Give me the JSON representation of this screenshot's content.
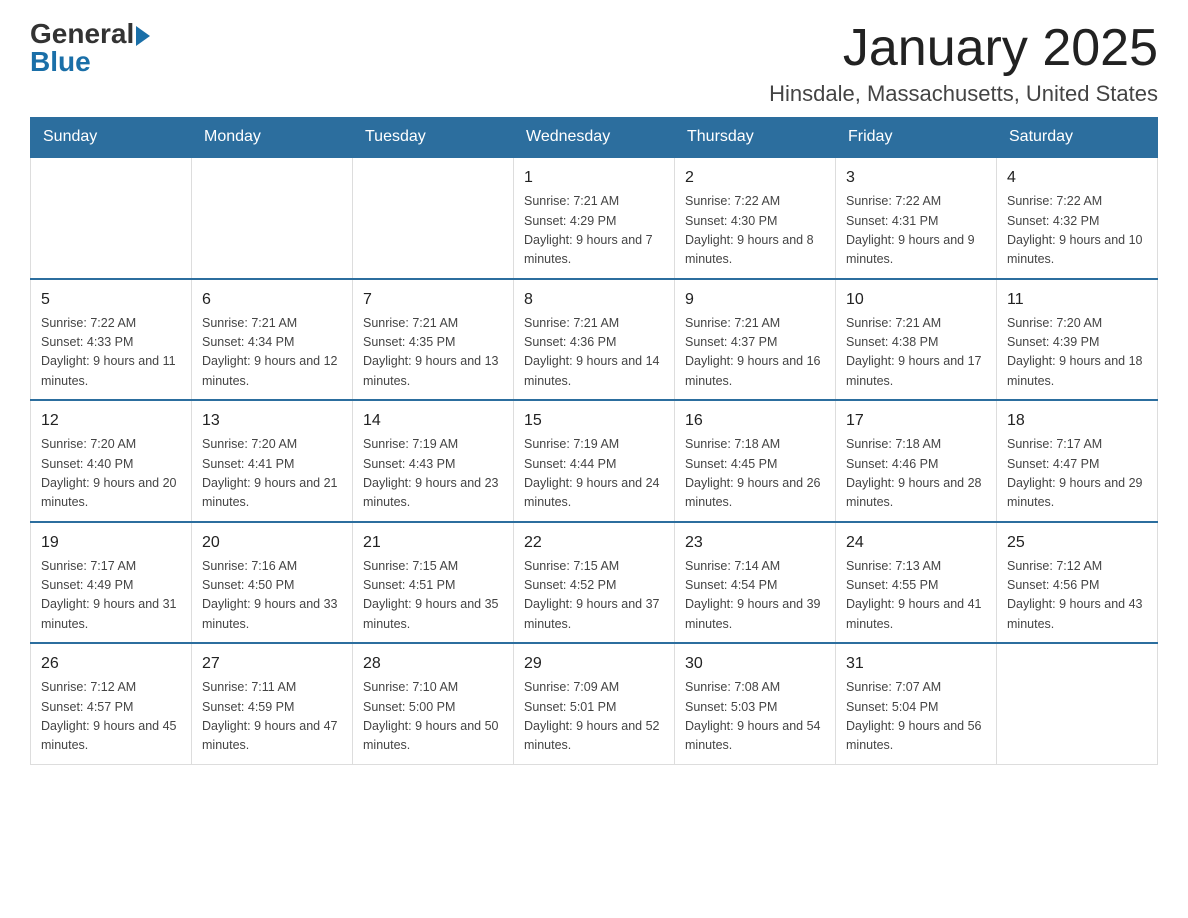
{
  "logo": {
    "general": "General",
    "blue": "Blue"
  },
  "title": {
    "month_year": "January 2025",
    "location": "Hinsdale, Massachusetts, United States"
  },
  "weekdays": [
    "Sunday",
    "Monday",
    "Tuesday",
    "Wednesday",
    "Thursday",
    "Friday",
    "Saturday"
  ],
  "weeks": [
    [
      {
        "day": "",
        "info": ""
      },
      {
        "day": "",
        "info": ""
      },
      {
        "day": "",
        "info": ""
      },
      {
        "day": "1",
        "info": "Sunrise: 7:21 AM\nSunset: 4:29 PM\nDaylight: 9 hours\nand 7 minutes."
      },
      {
        "day": "2",
        "info": "Sunrise: 7:22 AM\nSunset: 4:30 PM\nDaylight: 9 hours\nand 8 minutes."
      },
      {
        "day": "3",
        "info": "Sunrise: 7:22 AM\nSunset: 4:31 PM\nDaylight: 9 hours\nand 9 minutes."
      },
      {
        "day": "4",
        "info": "Sunrise: 7:22 AM\nSunset: 4:32 PM\nDaylight: 9 hours\nand 10 minutes."
      }
    ],
    [
      {
        "day": "5",
        "info": "Sunrise: 7:22 AM\nSunset: 4:33 PM\nDaylight: 9 hours\nand 11 minutes."
      },
      {
        "day": "6",
        "info": "Sunrise: 7:21 AM\nSunset: 4:34 PM\nDaylight: 9 hours\nand 12 minutes."
      },
      {
        "day": "7",
        "info": "Sunrise: 7:21 AM\nSunset: 4:35 PM\nDaylight: 9 hours\nand 13 minutes."
      },
      {
        "day": "8",
        "info": "Sunrise: 7:21 AM\nSunset: 4:36 PM\nDaylight: 9 hours\nand 14 minutes."
      },
      {
        "day": "9",
        "info": "Sunrise: 7:21 AM\nSunset: 4:37 PM\nDaylight: 9 hours\nand 16 minutes."
      },
      {
        "day": "10",
        "info": "Sunrise: 7:21 AM\nSunset: 4:38 PM\nDaylight: 9 hours\nand 17 minutes."
      },
      {
        "day": "11",
        "info": "Sunrise: 7:20 AM\nSunset: 4:39 PM\nDaylight: 9 hours\nand 18 minutes."
      }
    ],
    [
      {
        "day": "12",
        "info": "Sunrise: 7:20 AM\nSunset: 4:40 PM\nDaylight: 9 hours\nand 20 minutes."
      },
      {
        "day": "13",
        "info": "Sunrise: 7:20 AM\nSunset: 4:41 PM\nDaylight: 9 hours\nand 21 minutes."
      },
      {
        "day": "14",
        "info": "Sunrise: 7:19 AM\nSunset: 4:43 PM\nDaylight: 9 hours\nand 23 minutes."
      },
      {
        "day": "15",
        "info": "Sunrise: 7:19 AM\nSunset: 4:44 PM\nDaylight: 9 hours\nand 24 minutes."
      },
      {
        "day": "16",
        "info": "Sunrise: 7:18 AM\nSunset: 4:45 PM\nDaylight: 9 hours\nand 26 minutes."
      },
      {
        "day": "17",
        "info": "Sunrise: 7:18 AM\nSunset: 4:46 PM\nDaylight: 9 hours\nand 28 minutes."
      },
      {
        "day": "18",
        "info": "Sunrise: 7:17 AM\nSunset: 4:47 PM\nDaylight: 9 hours\nand 29 minutes."
      }
    ],
    [
      {
        "day": "19",
        "info": "Sunrise: 7:17 AM\nSunset: 4:49 PM\nDaylight: 9 hours\nand 31 minutes."
      },
      {
        "day": "20",
        "info": "Sunrise: 7:16 AM\nSunset: 4:50 PM\nDaylight: 9 hours\nand 33 minutes."
      },
      {
        "day": "21",
        "info": "Sunrise: 7:15 AM\nSunset: 4:51 PM\nDaylight: 9 hours\nand 35 minutes."
      },
      {
        "day": "22",
        "info": "Sunrise: 7:15 AM\nSunset: 4:52 PM\nDaylight: 9 hours\nand 37 minutes."
      },
      {
        "day": "23",
        "info": "Sunrise: 7:14 AM\nSunset: 4:54 PM\nDaylight: 9 hours\nand 39 minutes."
      },
      {
        "day": "24",
        "info": "Sunrise: 7:13 AM\nSunset: 4:55 PM\nDaylight: 9 hours\nand 41 minutes."
      },
      {
        "day": "25",
        "info": "Sunrise: 7:12 AM\nSunset: 4:56 PM\nDaylight: 9 hours\nand 43 minutes."
      }
    ],
    [
      {
        "day": "26",
        "info": "Sunrise: 7:12 AM\nSunset: 4:57 PM\nDaylight: 9 hours\nand 45 minutes."
      },
      {
        "day": "27",
        "info": "Sunrise: 7:11 AM\nSunset: 4:59 PM\nDaylight: 9 hours\nand 47 minutes."
      },
      {
        "day": "28",
        "info": "Sunrise: 7:10 AM\nSunset: 5:00 PM\nDaylight: 9 hours\nand 50 minutes."
      },
      {
        "day": "29",
        "info": "Sunrise: 7:09 AM\nSunset: 5:01 PM\nDaylight: 9 hours\nand 52 minutes."
      },
      {
        "day": "30",
        "info": "Sunrise: 7:08 AM\nSunset: 5:03 PM\nDaylight: 9 hours\nand 54 minutes."
      },
      {
        "day": "31",
        "info": "Sunrise: 7:07 AM\nSunset: 5:04 PM\nDaylight: 9 hours\nand 56 minutes."
      },
      {
        "day": "",
        "info": ""
      }
    ]
  ]
}
